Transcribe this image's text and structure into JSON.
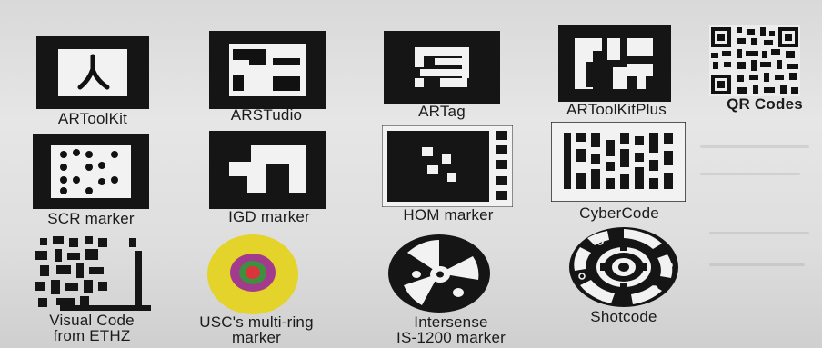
{
  "markers": [
    {
      "id": "artoolkit",
      "label": "ARToolKit",
      "icon": "artoolkit-marker"
    },
    {
      "id": "arstudio",
      "label": "ARSTudio",
      "icon": "arstudio-marker"
    },
    {
      "id": "artag",
      "label": "ARTag",
      "icon": "artag-marker"
    },
    {
      "id": "artoolkitplus",
      "label": "ARToolKitPlus",
      "icon": "artoolkitplus-marker"
    },
    {
      "id": "qr",
      "label": "QR Codes",
      "icon": "qr-code"
    },
    {
      "id": "scr",
      "label": "SCR marker",
      "icon": "scr-marker"
    },
    {
      "id": "igd",
      "label": "IGD marker",
      "icon": "igd-marker"
    },
    {
      "id": "hom",
      "label": "HOM marker",
      "icon": "hom-marker"
    },
    {
      "id": "cybercode",
      "label": "CyberCode",
      "icon": "cybercode-marker"
    },
    {
      "id": "ethz",
      "label_lines": [
        "Visual Code",
        "from ETHZ"
      ],
      "icon": "visual-code-marker"
    },
    {
      "id": "usc",
      "label_lines": [
        "USC's multi-ring",
        "marker"
      ],
      "icon": "multi-ring-marker"
    },
    {
      "id": "intersense",
      "label_lines": [
        "Intersense",
        "IS-1200 marker"
      ],
      "icon": "intersense-marker"
    },
    {
      "id": "shotcode",
      "label": "Shotcode",
      "icon": "shotcode-marker"
    }
  ],
  "colors": {
    "ink": "#111111",
    "paper": "#f4f4f4",
    "ring_yellow": "#e3d32a",
    "ring_purple": "#a23a8e",
    "ring_green": "#3f8f3f",
    "ring_red": "#d9353a"
  }
}
